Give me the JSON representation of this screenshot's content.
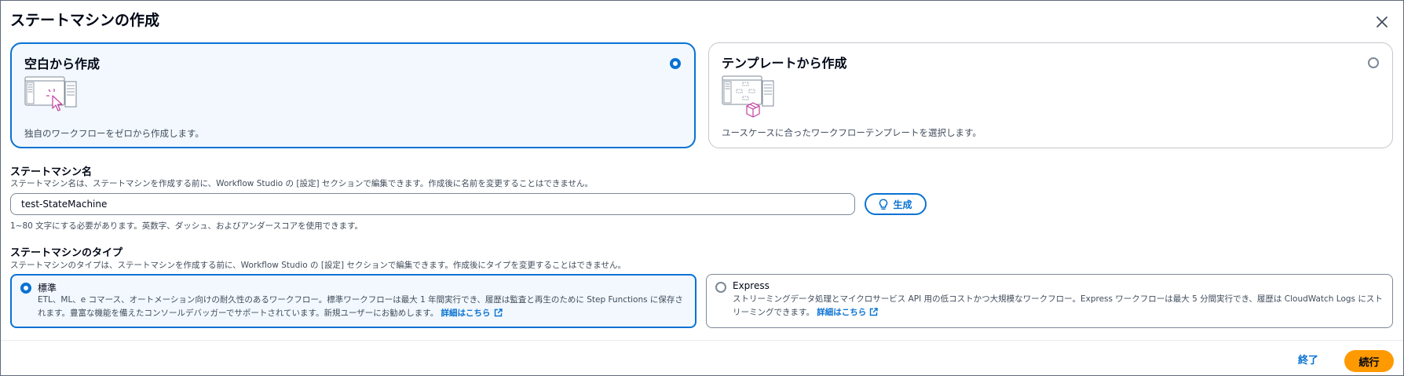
{
  "dialog": {
    "title": "ステートマシンの作成"
  },
  "create_options": [
    {
      "title": "空白から作成",
      "description": "独自のワークフローをゼロから作成します。",
      "selected": true
    },
    {
      "title": "テンプレートから作成",
      "description": "ユースケースに合ったワークフローテンプレートを選択します。",
      "selected": false
    }
  ],
  "name_section": {
    "label": "ステートマシン名",
    "description": "ステートマシン名は、ステートマシンを作成する前に、Workflow Studio の [設定] セクションで編集できます。作成後に名前を変更することはできません。",
    "value": "test-StateMachine",
    "generate_label": "生成",
    "hint": "1~80 文字にする必要があります。英数字、ダッシュ、およびアンダースコアを使用できます。"
  },
  "type_section": {
    "label": "ステートマシンのタイプ",
    "description": "ステートマシンのタイプは、ステートマシンを作成する前に、Workflow Studio の [設定] セクションで編集できます。作成後にタイプを変更することはできません。",
    "options": [
      {
        "title": "標準",
        "description": "ETL、ML、e コマース、オートメーション向けの耐久性のあるワークフロー。標準ワークフローは最大 1 年間実行でき、履歴は監査と再生のために Step Functions に保存されます。豊富な機能を備えたコンソールデバッガーでサポートされています。新規ユーザーにお勧めします。",
        "link": "詳細はこちら",
        "selected": true
      },
      {
        "title": "Express",
        "description": "ストリーミングデータ処理とマイクロサービス API 用の低コストかつ大規模なワークフロー。Express ワークフローは最大 5 分間実行でき、履歴は CloudWatch Logs にストリーミングできます。",
        "link": "詳細はこちら",
        "selected": false
      }
    ]
  },
  "footer": {
    "exit_label": "終了",
    "continue_label": "続行"
  },
  "colors": {
    "accent": "#0972d3",
    "primary_button": "#ff9900",
    "selected_bg": "#f2f8fd",
    "illustration_accent": "#c33d9f"
  },
  "icons": {
    "close": "close-icon",
    "generate": "lightbulb-icon",
    "external_link": "external-link-icon"
  }
}
